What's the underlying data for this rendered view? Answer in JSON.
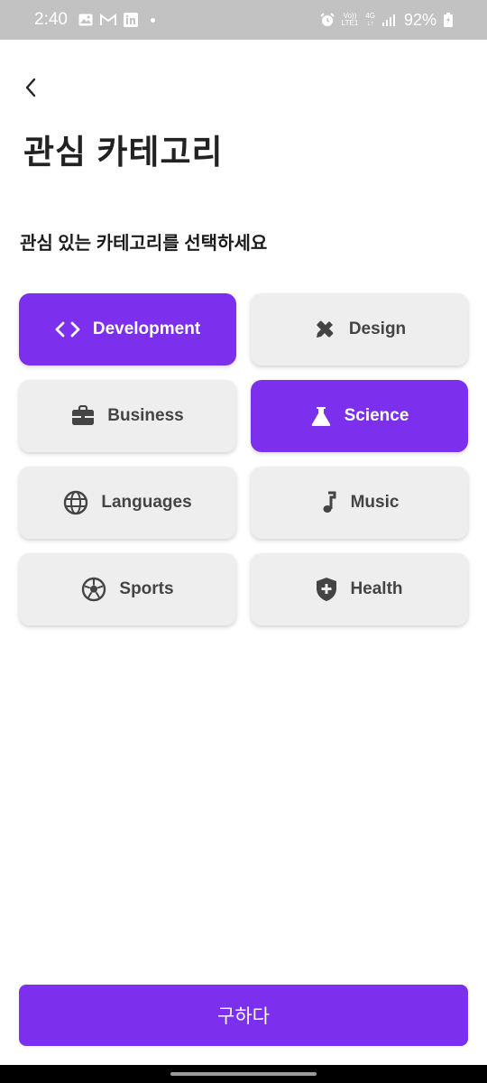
{
  "status_bar": {
    "time": "2:40",
    "network_lte": "LTE1",
    "network_volte": "Vo))",
    "network_4g": "4G",
    "battery": "92%"
  },
  "header": {
    "title": "관심 카테고리",
    "subtitle": "관심 있는 카테고리를 선택하세요"
  },
  "categories": [
    {
      "label": "Development",
      "icon": "code-icon",
      "selected": true
    },
    {
      "label": "Design",
      "icon": "design-icon",
      "selected": false
    },
    {
      "label": "Business",
      "icon": "briefcase-icon",
      "selected": false
    },
    {
      "label": "Science",
      "icon": "flask-icon",
      "selected": true
    },
    {
      "label": "Languages",
      "icon": "globe-icon",
      "selected": false
    },
    {
      "label": "Music",
      "icon": "music-note-icon",
      "selected": false
    },
    {
      "label": "Sports",
      "icon": "soccer-ball-icon",
      "selected": false
    },
    {
      "label": "Health",
      "icon": "health-shield-icon",
      "selected": false
    }
  ],
  "submit": {
    "label": "구하다"
  },
  "colors": {
    "accent": "#7c2fec",
    "card": "#eeeeee",
    "card_text": "#444444"
  }
}
